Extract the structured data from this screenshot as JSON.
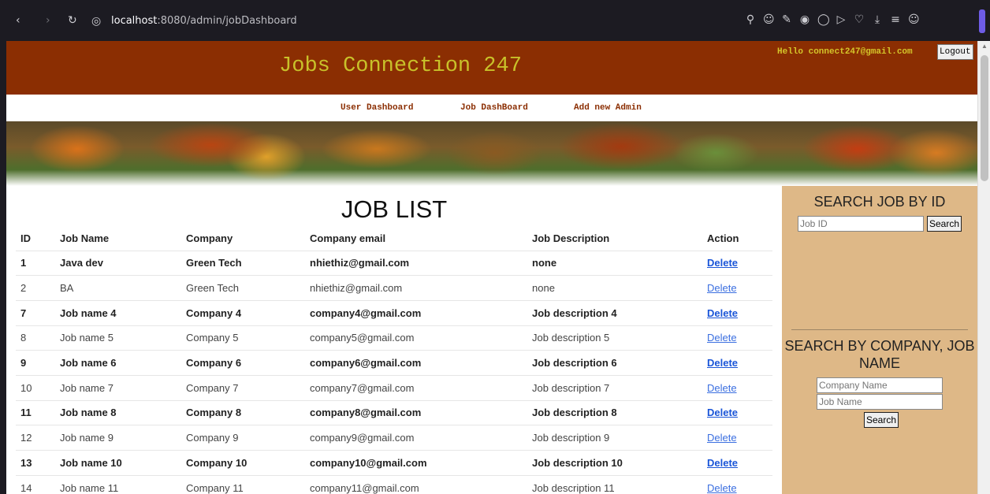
{
  "browser": {
    "url_host": "localhost",
    "url_rest": ":8080/admin/jobDashboard",
    "icons": [
      "back-icon",
      "forward-icon",
      "reload-icon",
      "globe-icon"
    ],
    "toolbar_icons": [
      "search-icon",
      "smile-icon",
      "edit-icon",
      "camera-icon",
      "shield-icon",
      "play-icon",
      "heart-icon",
      "download-icon",
      "menu-icon",
      "account-icon"
    ]
  },
  "header": {
    "title": "Jobs Connection 247",
    "greeting": "Hello connect247@gmail.com",
    "logout_label": "Logout",
    "bg_color": "#8b2e02",
    "title_color": "#c8c12a"
  },
  "nav": {
    "items": [
      {
        "label": "User Dashboard"
      },
      {
        "label": "Job DashBoard"
      },
      {
        "label": "Add new Admin"
      }
    ]
  },
  "main": {
    "title": "JOB LIST",
    "columns": [
      "ID",
      "Job Name",
      "Company",
      "Company email",
      "Job Description",
      "Action"
    ],
    "rows": [
      {
        "id": "1",
        "job_name": "Java dev",
        "company": "Green Tech",
        "email": "nhiethiz@gmail.com",
        "description": "none",
        "action": "Delete",
        "bold": true
      },
      {
        "id": "2",
        "job_name": "BA",
        "company": "Green Tech",
        "email": "nhiethiz@gmail.com",
        "description": "none",
        "action": "Delete",
        "bold": false
      },
      {
        "id": "7",
        "job_name": "Job name 4",
        "company": "Company 4",
        "email": "company4@gmail.com",
        "description": "Job description 4",
        "action": "Delete",
        "bold": true
      },
      {
        "id": "8",
        "job_name": "Job name 5",
        "company": "Company 5",
        "email": "company5@gmail.com",
        "description": "Job description 5",
        "action": "Delete",
        "bold": false
      },
      {
        "id": "9",
        "job_name": "Job name 6",
        "company": "Company 6",
        "email": "company6@gmail.com",
        "description": "Job description 6",
        "action": "Delete",
        "bold": true
      },
      {
        "id": "10",
        "job_name": "Job name 7",
        "company": "Company 7",
        "email": "company7@gmail.com",
        "description": "Job description 7",
        "action": "Delete",
        "bold": false
      },
      {
        "id": "11",
        "job_name": "Job name 8",
        "company": "Company 8",
        "email": "company8@gmail.com",
        "description": "Job description 8",
        "action": "Delete",
        "bold": true
      },
      {
        "id": "12",
        "job_name": "Job name 9",
        "company": "Company 9",
        "email": "company9@gmail.com",
        "description": "Job description 9",
        "action": "Delete",
        "bold": false
      },
      {
        "id": "13",
        "job_name": "Job name 10",
        "company": "Company 10",
        "email": "company10@gmail.com",
        "description": "Job description 10",
        "action": "Delete",
        "bold": true
      },
      {
        "id": "14",
        "job_name": "Job name 11",
        "company": "Company 11",
        "email": "company11@gmail.com",
        "description": "Job description 11",
        "action": "Delete",
        "bold": false
      }
    ]
  },
  "sidebar": {
    "search_id_title": "SEARCH JOB BY ID",
    "job_id_placeholder": "Job ID",
    "search_label": "Search",
    "search_company_title": "SEARCH BY COMPANY, JOB NAME",
    "company_placeholder": "Company Name",
    "job_name_placeholder": "Job Name",
    "search_label_2": "Search",
    "bg_color": "#deb887"
  }
}
